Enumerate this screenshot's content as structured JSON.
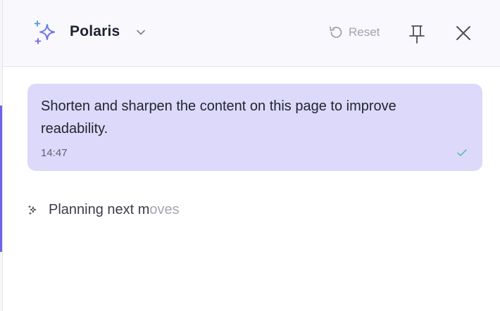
{
  "header": {
    "assistant_name": "Polaris",
    "reset_label": "Reset"
  },
  "message": {
    "text": "Shorten and sharpen the content on this page to improve readability.",
    "time": "14:47",
    "status_icon": "check-icon"
  },
  "status": {
    "text_main": "Planning next m",
    "text_fade": "oves"
  },
  "colors": {
    "accent": "#6b63e8",
    "bubble": "#dcd9fa",
    "check": "#5cc3a4",
    "muted": "#a0a3ae"
  }
}
